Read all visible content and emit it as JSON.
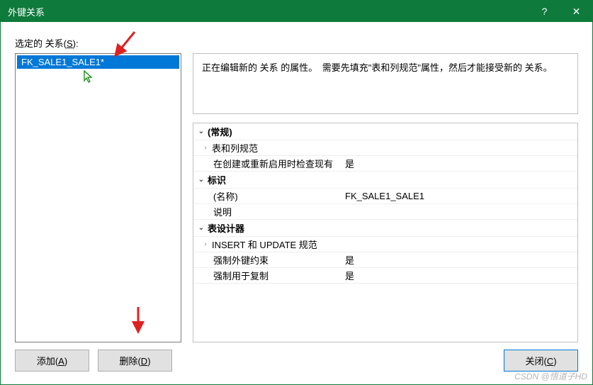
{
  "title": "外键关系",
  "label_selected": "选定的 关系(S):",
  "list": {
    "selected_item": "FK_SALE1_SALE1*"
  },
  "buttons": {
    "add": "添加(A)",
    "delete": "删除(D)",
    "close": "关闭(C)"
  },
  "description": "正在编辑新的 关系 的属性。　需要先填充\"表和列规范\"属性，然后才能接受新的 关系。",
  "props": {
    "group_general": "(常规)",
    "row_tablecol": "表和列规范",
    "row_check_label": "在创建或重新启用时检查现有",
    "row_check_value": "是",
    "group_identity": "标识",
    "row_name_label": "(名称)",
    "row_name_value": "FK_SALE1_SALE1",
    "row_desc_label": "说明",
    "row_desc_value": "",
    "group_designer": "表设计器",
    "row_insert_update": "INSERT 和 UPDATE 规范",
    "row_enforce_fk_label": "强制外键约束",
    "row_enforce_fk_value": "是",
    "row_replication_label": "强制用于复制",
    "row_replication_value": "是"
  },
  "watermark": "CSDN @悟道子HD"
}
